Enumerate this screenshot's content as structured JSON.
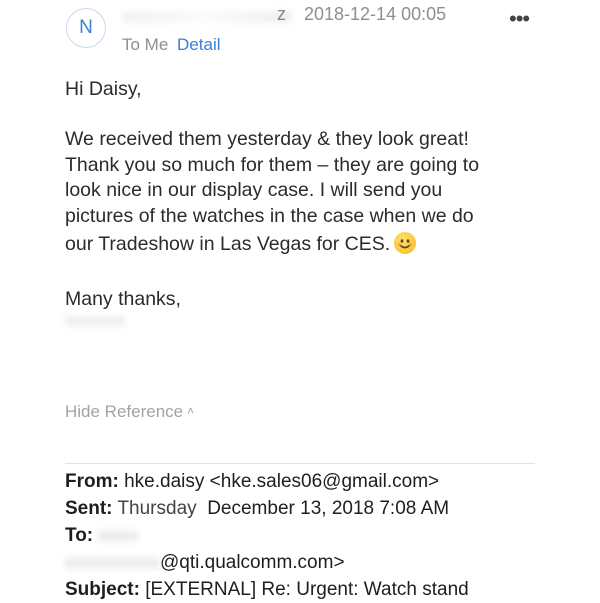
{
  "header": {
    "avatar_letter": "N",
    "sender_partial": "z",
    "date": "2018-12-14 00:05",
    "more": "•••",
    "to_label": "To Me",
    "detail_label": "Detail"
  },
  "message": {
    "greeting": "Hi Daisy,",
    "lines": [
      "We received them yesterday & they look great!",
      "Thank you so much for them – they are going to",
      "look nice in our display case. I will send you",
      "pictures of the watches in the case when we do",
      "our Tradeshow in Las Vegas for CES."
    ],
    "sign_off": "Many thanks,"
  },
  "reference": {
    "toggle_label": "Hide Reference",
    "from_label": "From:",
    "from_value": "hke.daisy <hke.sales06@gmail.com>",
    "sent_label": "Sent:",
    "sent_value_visible": "Thursday",
    "sent_value_rest": "December 13, 2018 7:08 AM",
    "to_label": "To:",
    "to_value_partial": "@qti.qualcomm.com>",
    "subject_label": "Subject:",
    "subject_value": "[EXTERNAL] Re: Urgent: Watch stand"
  }
}
